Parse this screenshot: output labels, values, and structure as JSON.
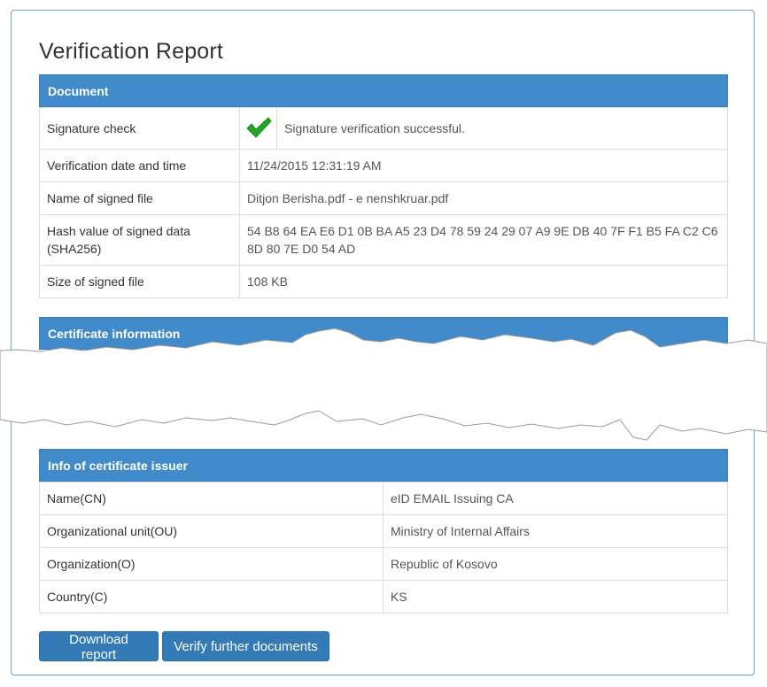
{
  "page": {
    "title": "Verification Report"
  },
  "document_panel": {
    "header": "Document",
    "rows": {
      "signature": {
        "label": "Signature check",
        "value": "Signature verification successful."
      },
      "date": {
        "label": "Verification date and time",
        "value": "11/24/2015 12:31:19 AM"
      },
      "file": {
        "label": "Name of signed file",
        "value": "Ditjon Berisha.pdf - e nenshkruar.pdf"
      },
      "hash": {
        "label": "Hash value of signed data (SHA256)",
        "value": "54 B8 64 EA E6 D1 0B BA A5 23 D4 78 59 24 29 07 A9 9E DB 40 7F F1 B5 FA C2 C6 8D 80 7E D0 54 AD"
      },
      "size": {
        "label": "Size of signed file",
        "value": "108 KB"
      }
    }
  },
  "certificate_panel": {
    "header": "Certificate information"
  },
  "issuer_panel": {
    "header": "Info of certificate issuer",
    "rows": [
      {
        "label": "Name(CN)",
        "value": "eID EMAIL Issuing CA"
      },
      {
        "label": "Organizational unit(OU)",
        "value": "Ministry of Internal Affairs"
      },
      {
        "label": "Organization(O)",
        "value": "Republic of Kosovo"
      },
      {
        "label": "Country(C)",
        "value": "KS"
      }
    ]
  },
  "buttons": {
    "download": "Download report",
    "verify": "Verify further documents"
  },
  "colors": {
    "accent": "#428bca",
    "button": "#337ab7",
    "check": "#22aa22"
  },
  "icons": {
    "signature_status": "checkmark-icon"
  }
}
